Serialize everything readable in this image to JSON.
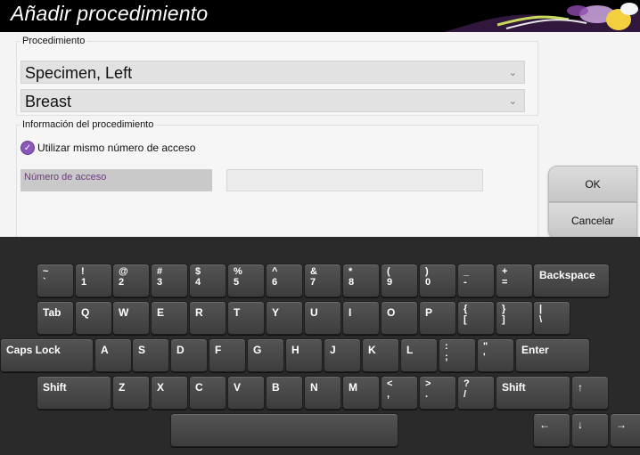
{
  "window": {
    "title": "Añadir procedimiento"
  },
  "procedure": {
    "legend": "Procedimiento",
    "select1": "Specimen, Left",
    "select2": "Breast"
  },
  "info": {
    "legend": "Información del procedimiento",
    "checkbox_label": "Utilizar mismo número de acceso",
    "checkbox_checked": true,
    "accession_label": "Número de acceso",
    "accession_value": ""
  },
  "buttons": {
    "ok": "OK",
    "cancel": "Cancelar"
  },
  "keyboard": {
    "row1": [
      {
        "s": "~",
        "m": "`"
      },
      {
        "s": "!",
        "m": "1"
      },
      {
        "s": "@",
        "m": "2"
      },
      {
        "s": "#",
        "m": "3"
      },
      {
        "s": "$",
        "m": "4"
      },
      {
        "s": "%",
        "m": "5"
      },
      {
        "s": "^",
        "m": "6"
      },
      {
        "s": "&",
        "m": "7"
      },
      {
        "s": "*",
        "m": "8"
      },
      {
        "s": "(",
        "m": "9"
      },
      {
        "s": ")",
        "m": "0"
      },
      {
        "s": "_",
        "m": "-"
      },
      {
        "s": "+",
        "m": "="
      },
      {
        "s": "",
        "m": "Backspace"
      }
    ],
    "row2": [
      {
        "s": "",
        "m": "Tab"
      },
      {
        "s": "",
        "m": "Q"
      },
      {
        "s": "",
        "m": "W"
      },
      {
        "s": "",
        "m": "E"
      },
      {
        "s": "",
        "m": "R"
      },
      {
        "s": "",
        "m": "T"
      },
      {
        "s": "",
        "m": "Y"
      },
      {
        "s": "",
        "m": "U"
      },
      {
        "s": "",
        "m": "I"
      },
      {
        "s": "",
        "m": "O"
      },
      {
        "s": "",
        "m": "P"
      },
      {
        "s": "{",
        "m": "["
      },
      {
        "s": "}",
        "m": "]"
      },
      {
        "s": "|",
        "m": "\\"
      }
    ],
    "row3": [
      {
        "s": "",
        "m": "Caps Lock"
      },
      {
        "s": "",
        "m": "A"
      },
      {
        "s": "",
        "m": "S"
      },
      {
        "s": "",
        "m": "D"
      },
      {
        "s": "",
        "m": "F"
      },
      {
        "s": "",
        "m": "G"
      },
      {
        "s": "",
        "m": "H"
      },
      {
        "s": "",
        "m": "J"
      },
      {
        "s": "",
        "m": "K"
      },
      {
        "s": "",
        "m": "L"
      },
      {
        "s": ":",
        "m": ";"
      },
      {
        "s": "\"",
        "m": "'"
      },
      {
        "s": "",
        "m": "Enter"
      }
    ],
    "row4": [
      {
        "s": "",
        "m": "Shift"
      },
      {
        "s": "",
        "m": "Z"
      },
      {
        "s": "",
        "m": "X"
      },
      {
        "s": "",
        "m": "C"
      },
      {
        "s": "",
        "m": "V"
      },
      {
        "s": "",
        "m": "B"
      },
      {
        "s": "",
        "m": "N"
      },
      {
        "s": "",
        "m": "M"
      },
      {
        "s": "<",
        "m": ","
      },
      {
        "s": ">",
        "m": "."
      },
      {
        "s": "?",
        "m": "/"
      },
      {
        "s": "",
        "m": "Shift"
      },
      {
        "s": "",
        "m": "↑"
      }
    ],
    "row5": [
      {
        "s": "",
        "m": ""
      },
      {
        "s": "",
        "m": "←"
      },
      {
        "s": "",
        "m": "↓"
      },
      {
        "s": "",
        "m": "→"
      }
    ]
  }
}
